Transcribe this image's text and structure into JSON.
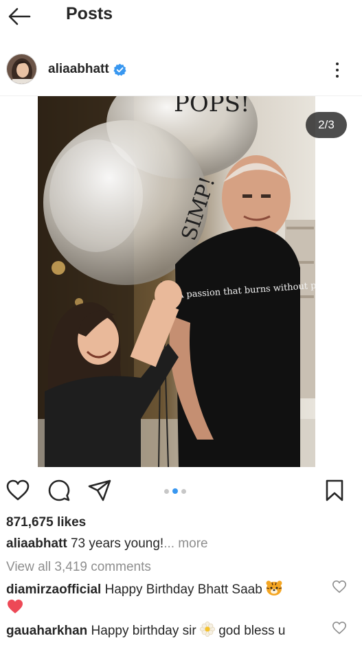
{
  "header": {
    "title": "Posts"
  },
  "post": {
    "username": "aliaabhatt",
    "verified": true,
    "carousel_indicator": "2/3",
    "carousel": {
      "count": 3,
      "active_index": 1
    },
    "photo_text": {
      "balloon_top": "POPS!",
      "balloon_left": "SIMP!",
      "tshirt": "A passion that burns without purpose"
    },
    "likes": "871,675 likes",
    "caption": {
      "username": "aliaabhatt",
      "text": "73 years young!",
      "more": "... more"
    },
    "view_all_comments": "View all 3,419 comments",
    "comments": [
      {
        "username": "diamirzaofficial",
        "text": "Happy Birthday Bhatt Saab",
        "emoji": "tiger-face"
      },
      {
        "username": "gauaharkhan",
        "text_before": "Happy birthday sir",
        "emoji": "blossom",
        "text_after": "god bless u"
      }
    ]
  },
  "colors": {
    "text": "#262626",
    "muted": "#8e8e8e",
    "accent_blue": "#3897f0",
    "verified_blue": "#3897f0",
    "heart_red": "#ed4956"
  },
  "icons": {
    "back": "back-arrow-icon",
    "verified": "verified-badge-icon",
    "more": "more-vertical-icon",
    "like": "heart-outline-icon",
    "comment": "comment-bubble-icon",
    "share": "paper-plane-icon",
    "save": "bookmark-icon",
    "comment_like": "small-heart-icon"
  }
}
